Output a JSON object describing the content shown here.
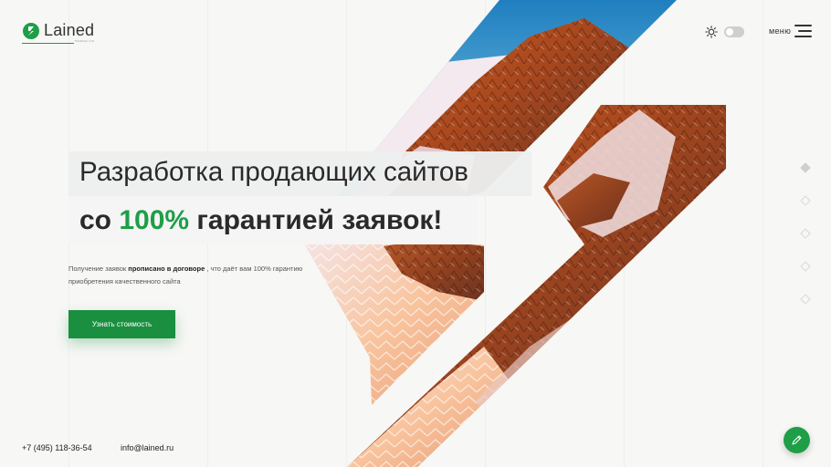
{
  "brand": {
    "name": "Lained",
    "tagline": "TRADING LTD",
    "accent_color": "#1e9e47"
  },
  "header": {
    "theme_icon": "sun-icon",
    "theme_toggle_state": "off",
    "menu_label": "меню",
    "menu_icon": "hamburger-icon"
  },
  "hero": {
    "headline_line1": "Разработка продающих сайтов",
    "headline_line2_prefix": "со ",
    "headline_line2_accent": "100%",
    "headline_line2_suffix": " гарантией заявок!",
    "description_prefix": "Получение заявок ",
    "description_bold": "прописано в договоре",
    "description_suffix": " , что даёт вам 100% гарантию приобретения качественного сайта",
    "cta_label": "Узнать стоимость"
  },
  "contacts": {
    "phone": "+7 (495) 118-36-54",
    "email": "info@lained.ru"
  },
  "slider": {
    "count": 5,
    "active_index": 0
  },
  "fab": {
    "icon": "pencil-icon"
  }
}
